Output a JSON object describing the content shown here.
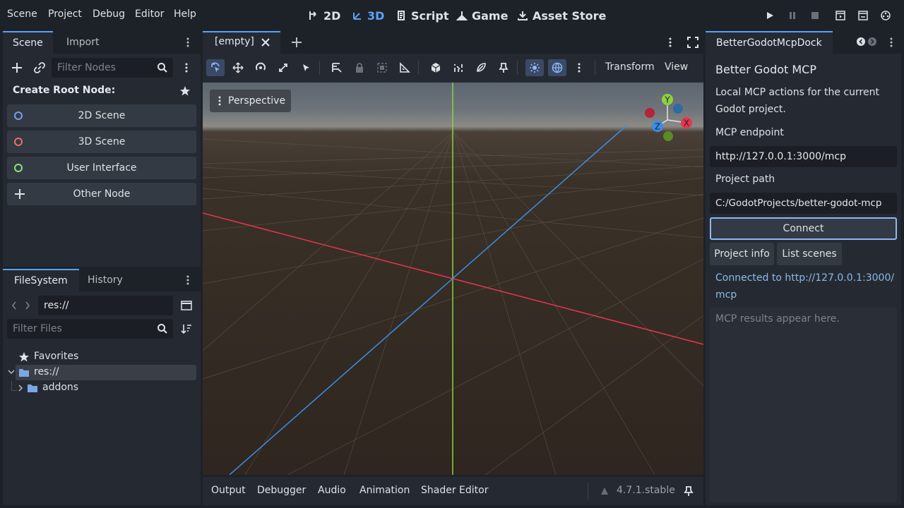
{
  "menu": [
    "Scene",
    "Project",
    "Debug",
    "Editor",
    "Help"
  ],
  "workspaces": [
    {
      "label": "2D",
      "icon": "2d-workspace-icon",
      "active": false
    },
    {
      "label": "3D",
      "icon": "3d-workspace-icon",
      "active": true
    },
    {
      "label": "Script",
      "icon": "script-icon",
      "active": false
    },
    {
      "label": "Game",
      "icon": "game-icon",
      "active": false
    },
    {
      "label": "Asset Store",
      "icon": "download-icon",
      "active": false
    }
  ],
  "scene_dock": {
    "tabs": [
      "Scene",
      "Import"
    ],
    "filter_placeholder": "Filter Nodes",
    "create_root_title": "Create Root Node:",
    "root_options": [
      {
        "label": "2D Scene",
        "color": "#7a9cf6"
      },
      {
        "label": "3D Scene",
        "color": "#f06a6a"
      },
      {
        "label": "User Interface",
        "color": "#8ee07a"
      },
      {
        "label": "Other Node",
        "color": "#dfe1e5"
      }
    ]
  },
  "filesystem": {
    "tabs": [
      "FileSystem",
      "History"
    ],
    "path": "res://",
    "filter_placeholder": "Filter Files",
    "tree": {
      "favorites": "Favorites",
      "root": "res://",
      "child": "addons"
    }
  },
  "editor": {
    "scene_tab": "[empty]",
    "toolbar_menus": [
      "Transform",
      "View"
    ],
    "perspective_label": "Perspective",
    "gizmo": {
      "y": "Y",
      "x": "X",
      "z": "Z"
    }
  },
  "bottom_panel": {
    "tabs": [
      "Output",
      "Debugger",
      "Audio",
      "Animation",
      "Shader Editor"
    ],
    "version": "4.7.1.stable"
  },
  "mcp_dock": {
    "tab": "BetterGodotMcpDock",
    "title": "Better Godot MCP",
    "description_line1": "Local MCP actions for the current",
    "description_line2": "Godot project.",
    "endpoint_label": "MCP endpoint",
    "endpoint_value": "http://127.0.0.1:3000/mcp",
    "path_label": "Project path",
    "path_value": "C:/GodotProjects/better-godot-mcp",
    "connect_button": "Connect",
    "project_info_button": "Project info",
    "list_scenes_button": "List scenes",
    "status_line1": "Connected to http://127.0.0.1:3000/",
    "status_line2": "mcp",
    "results_placeholder": "MCP results appear here."
  },
  "colors": {
    "accent": "#5aa2f7",
    "x_axis": "#e8354f",
    "y_axis": "#8fd13d",
    "z_axis": "#3a8ee6",
    "status": "#8db8e8"
  }
}
